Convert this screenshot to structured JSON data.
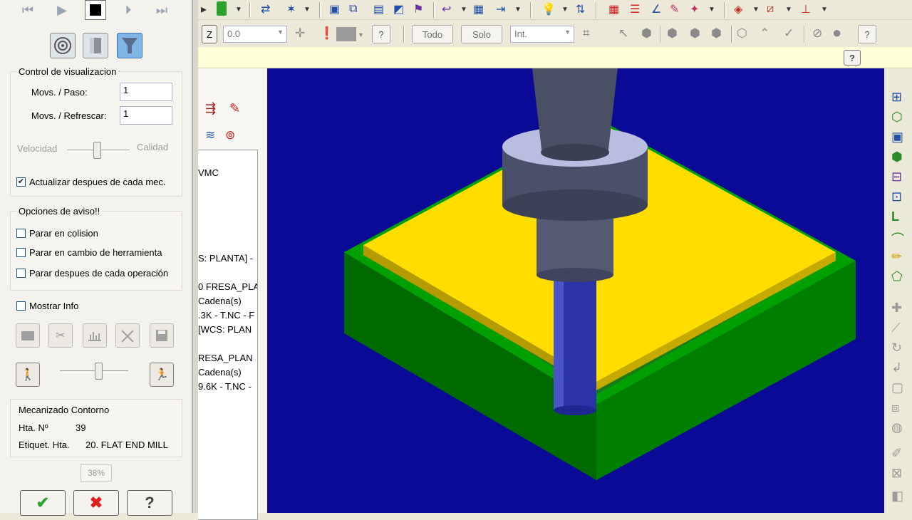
{
  "playback": {
    "first": "⏮",
    "play": "▶",
    "step": "⏵",
    "last": "⏭"
  },
  "display_control": {
    "title": "Control de visualizacion",
    "moves_per_step_label": "Movs. / Paso:",
    "moves_per_step_value": "1",
    "moves_per_refresh_label": "Movs. / Refrescar:",
    "moves_per_refresh_value": "1",
    "speed_label": "Velocidad",
    "quality_label": "Calidad",
    "update_after_each_label": "Actualizar despues de cada mec.",
    "update_after_each_checked": true
  },
  "warning_options": {
    "title": "Opciones de aviso!!",
    "stop_on_collision": "Parar en colision",
    "stop_on_tool_change": "Parar en cambio de herramienta",
    "stop_after_operation": "Parar despues de cada operación"
  },
  "show_info_label": "Mostrar Info",
  "info": {
    "operation": "Mecanizado Contorno",
    "tool_no_label": "Hta. Nº",
    "tool_no_value": "39",
    "tool_label_label": "Etiquet. Hta.",
    "tool_label_value": "20. FLAT END MILL"
  },
  "progress_percent": "38%",
  "toolbar": {
    "z_label": "Z",
    "z_value": "0.0",
    "todo_label": "Todo",
    "solo_label": "Solo",
    "int_label": "Int."
  },
  "tree_lines": [
    "VMC",
    "S: PLANTA] -",
    "0 FRESA_PLA",
    "Cadena(s)",
    ".3K - T.NC - F",
    "[WCS: PLAN",
    "RESA_PLAN",
    "Cadena(s)",
    "9.6K - T.NC -"
  ],
  "colors": {
    "viewport_bg": "#0a0a96",
    "stock_top": "#ffdd00",
    "stock_side": "#007a00",
    "tool_body": "#4a4e6a",
    "tool_cutter": "#2a33a8"
  }
}
